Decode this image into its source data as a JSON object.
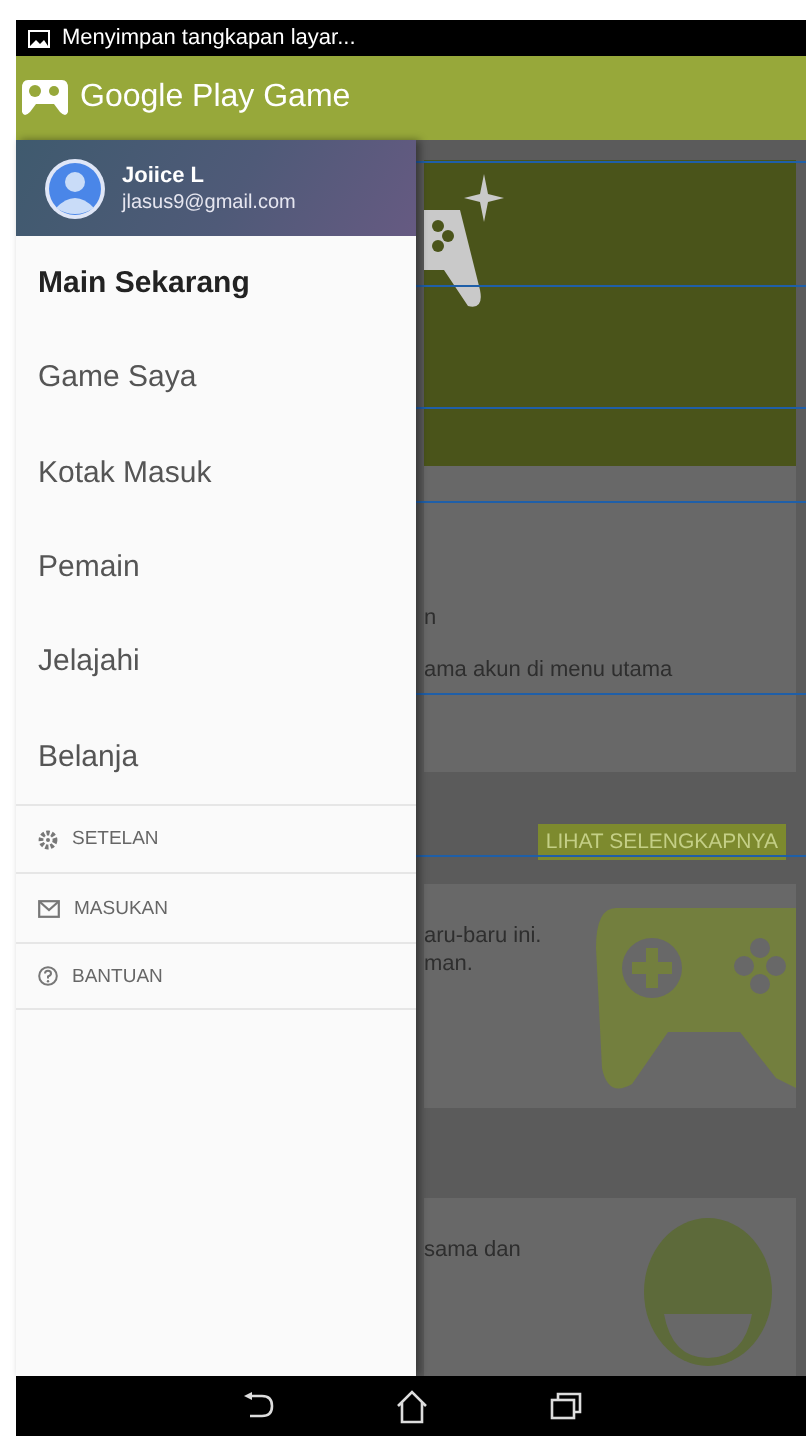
{
  "status_bar": {
    "notification": "Menyimpan tangkapan layar..."
  },
  "app_bar": {
    "title": "Google Play Game"
  },
  "drawer": {
    "account": {
      "name": "Joiice L",
      "email": "jlasus9@gmail.com"
    },
    "items": [
      {
        "label": "Main Sekarang",
        "selected": true
      },
      {
        "label": "Game Saya",
        "selected": false
      },
      {
        "label": "Kotak Masuk",
        "selected": false
      },
      {
        "label": "Pemain",
        "selected": false
      },
      {
        "label": "Jelajahi",
        "selected": false
      },
      {
        "label": "Belanja",
        "selected": false
      }
    ],
    "secondary_items": [
      {
        "kind": "settings",
        "label": "SETELAN"
      },
      {
        "kind": "feedback",
        "label": "MASUKAN"
      },
      {
        "kind": "help",
        "label": "BANTUAN"
      }
    ]
  },
  "background": {
    "card_lines": [
      "n",
      "ama akun di menu utama"
    ],
    "more_button": "LIHAT SELENGKAPNYA",
    "recent_lines": [
      "aru-baru ini.",
      "man."
    ],
    "friends_lines": [
      "sama dan"
    ]
  }
}
